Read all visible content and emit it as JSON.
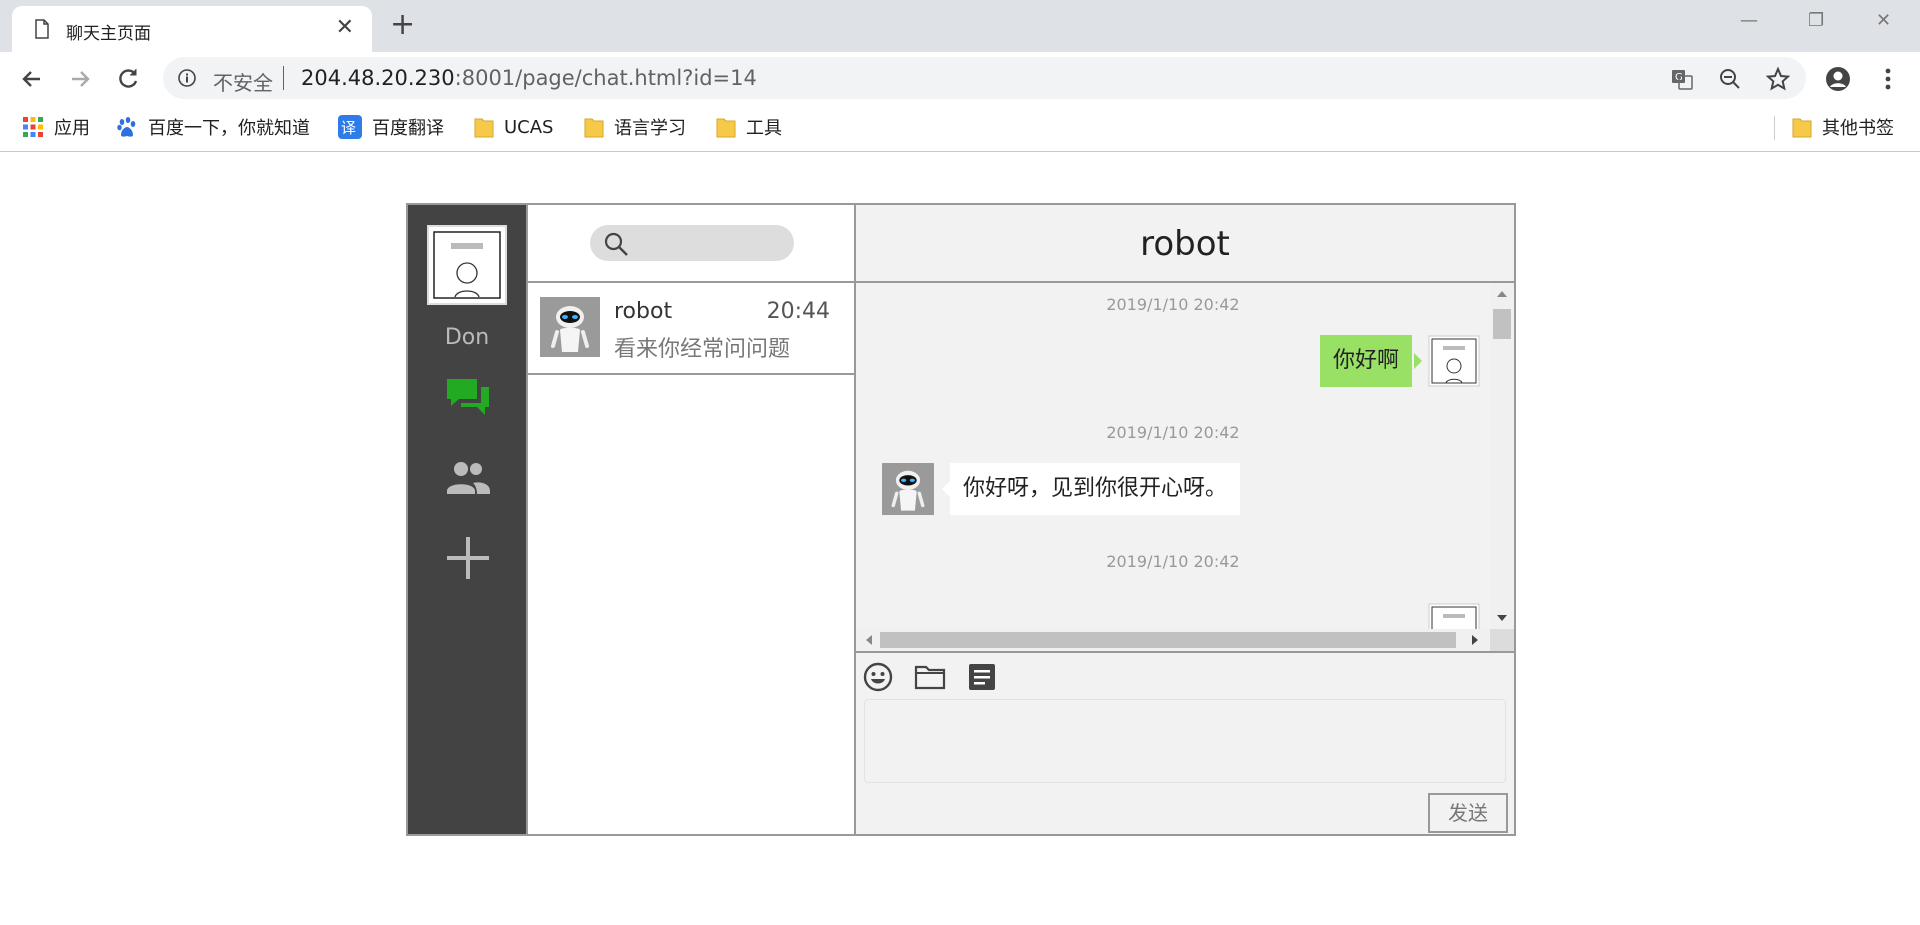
{
  "browser": {
    "tab_title": "聊天主页面",
    "insecure_label": "不安全",
    "url_host": "204.48.20.230",
    "url_rest": ":8001/page/chat.html?id=14",
    "bookmarks": [
      "应用",
      "百度一下，你就知道",
      "百度翻译",
      "UCAS",
      "语言学习",
      "工具"
    ],
    "other_bookmarks": "其他书签"
  },
  "chat": {
    "user_name": "Don",
    "contacts": [
      {
        "name": "robot",
        "time": "20:44",
        "last_message": "看来你经常问问题"
      }
    ],
    "active_chat_title": "robot",
    "messages": [
      {
        "timestamp": "2019/1/10 20:42",
        "sender": "me",
        "text": "你好啊"
      },
      {
        "timestamp": "2019/1/10 20:42",
        "sender": "robot",
        "text": "你好呀，见到你很开心呀。"
      },
      {
        "timestamp": "2019/1/10 20:42",
        "sender": "me",
        "text": ""
      }
    ],
    "send_label": "发送"
  },
  "colors": {
    "sidebar_bg": "#434343",
    "chat_active_icon": "#22aa22",
    "my_bubble": "#98e165",
    "panel_bg": "#f2f2f2"
  }
}
